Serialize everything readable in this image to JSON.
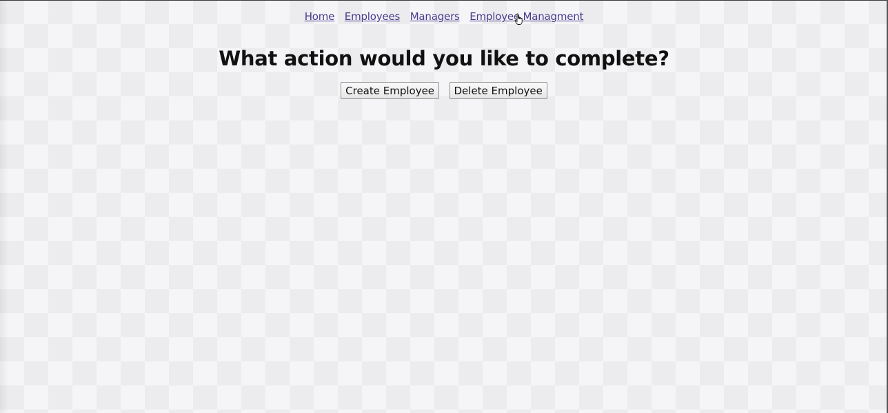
{
  "nav": {
    "items": [
      {
        "label": "Home"
      },
      {
        "label": "Employees"
      },
      {
        "label": "Managers"
      },
      {
        "label": "Employee Managment"
      }
    ]
  },
  "main": {
    "heading": "What action would you like to complete?",
    "buttons": {
      "create_label": "Create Employee",
      "delete_label": "Delete Employee"
    }
  },
  "icons": {
    "cursor": "hand-pointer-icon"
  }
}
